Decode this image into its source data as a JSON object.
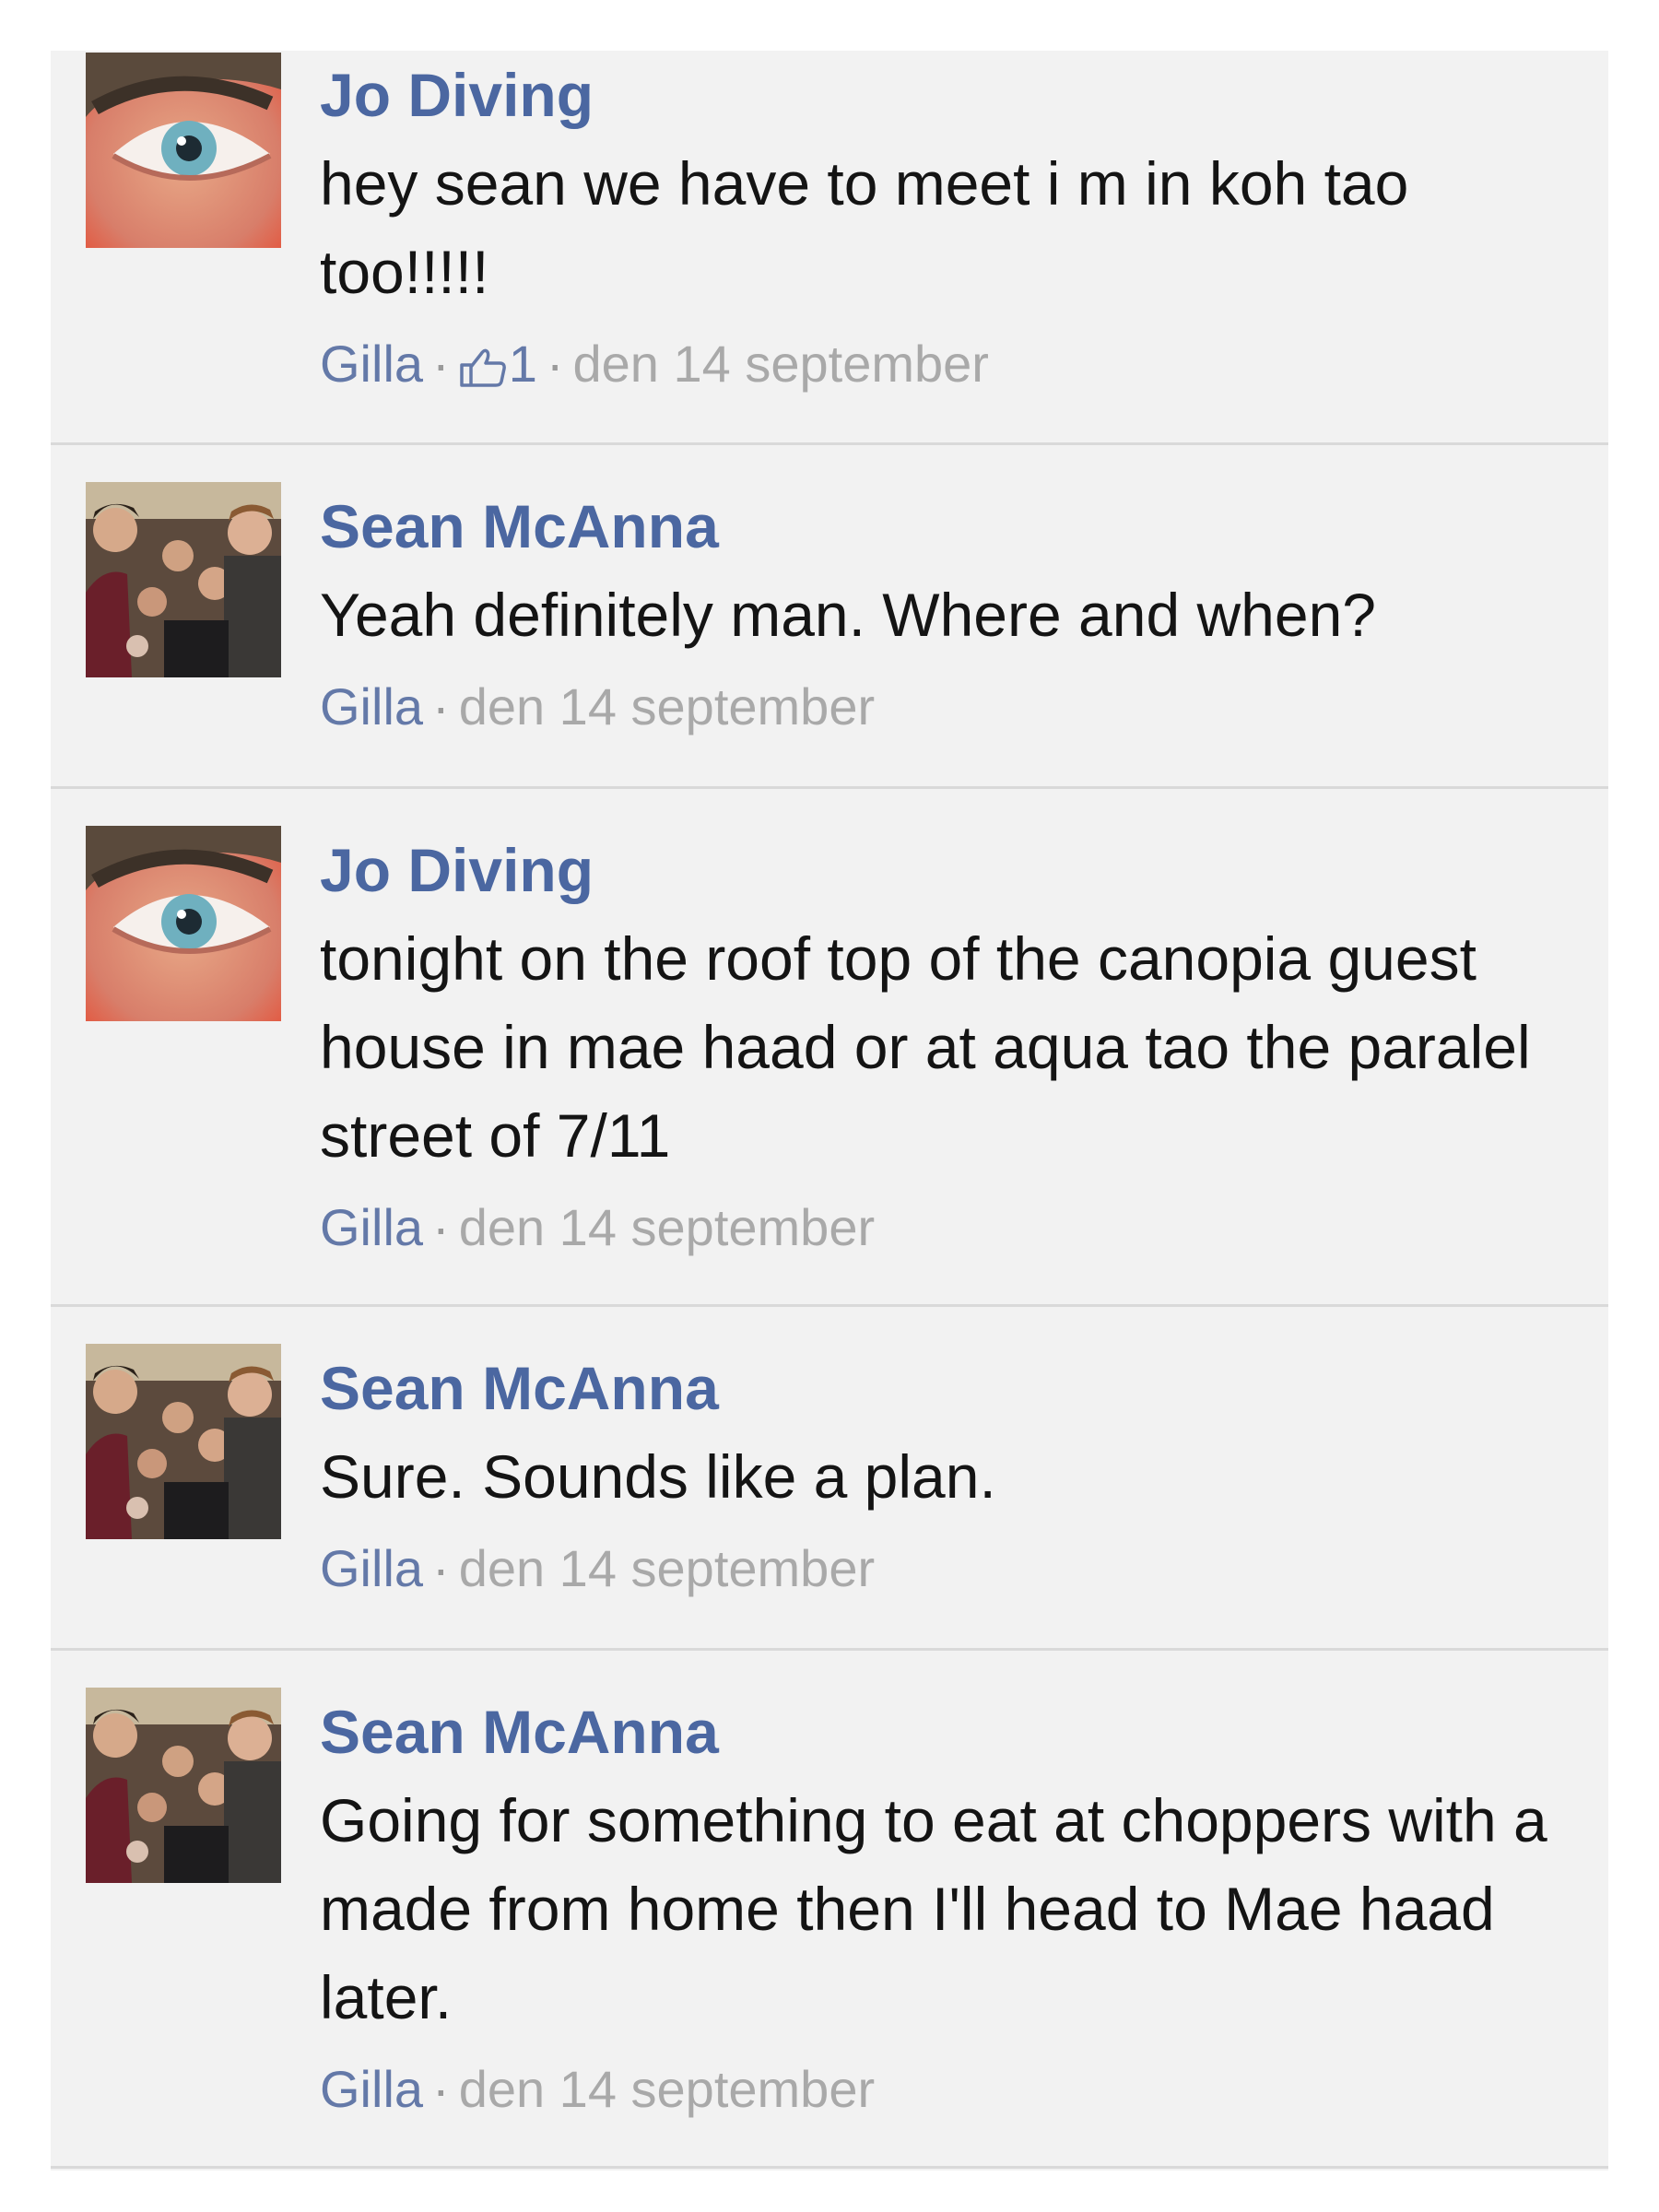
{
  "comments": [
    {
      "author": "Jo Diving",
      "text": "hey sean we have to meet i m in koh tao too!!!!!",
      "like_label": "Gilla",
      "separator": "·",
      "like_count": "1",
      "timestamp": "den 14 september"
    },
    {
      "author": "Sean McAnna",
      "text": "Yeah definitely man. Where and when?",
      "like_label": "Gilla",
      "separator": "·",
      "timestamp": "den 14 september"
    },
    {
      "author": "Jo Diving",
      "text": "tonight on the roof top of the canopia guest house in mae haad or at aqua tao the paralel street of 7/11",
      "like_label": "Gilla",
      "separator": "·",
      "timestamp": "den 14 september"
    },
    {
      "author": "Sean McAnna",
      "text": "Sure. Sounds like a plan.",
      "like_label": "Gilla",
      "separator": "·",
      "timestamp": "den 14 september"
    },
    {
      "author": "Sean McAnna",
      "text": "Going for something to eat at choppers with a made from home then I'll head to Mae haad later.",
      "like_label": "Gilla",
      "separator": "·",
      "timestamp": "den 14 september"
    }
  ],
  "colors": {
    "author_name": "#4b67a1",
    "link": "#6479a8",
    "timestamp": "#a9a9a9",
    "background": "#f2f2f2",
    "divider": "#d9d9d9"
  },
  "icons": {
    "like": "thumbs-up-icon"
  }
}
